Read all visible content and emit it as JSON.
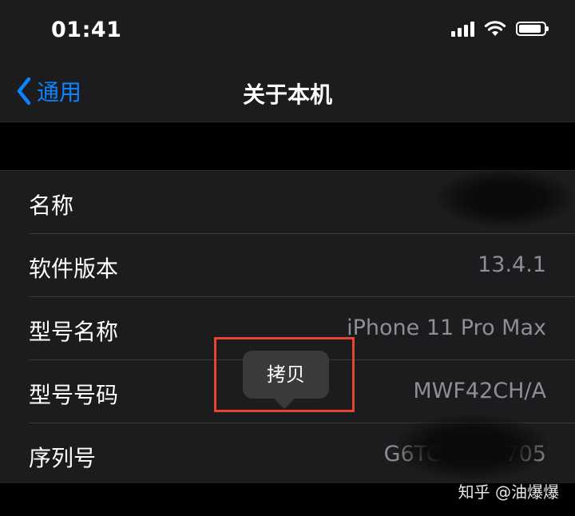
{
  "status_bar": {
    "time": "01:41",
    "cellular_icon": "cellular-signal-icon",
    "wifi_icon": "wifi-icon",
    "battery_icon": "battery-icon",
    "battery_level": 0.9
  },
  "nav": {
    "back_label": "通用",
    "back_icon": "chevron-left-icon",
    "title": "关于本机"
  },
  "rows": [
    {
      "label": "名称",
      "value": ""
    },
    {
      "label": "软件版本",
      "value": "13.4.1"
    },
    {
      "label": "型号名称",
      "value": "iPhone 11 Pro Max"
    },
    {
      "label": "型号号码",
      "value": "MWF42CH/A"
    },
    {
      "label": "序列号",
      "value": "G6TC",
      "value_tail": "705"
    }
  ],
  "tooltip": {
    "label": "拷贝"
  },
  "watermark": "知乎 @油爆爆",
  "colors": {
    "accent": "#0a84ff",
    "highlight": "#e8442f",
    "cell_bg": "#1c1c1e",
    "secondary_text": "#8e8e93"
  }
}
